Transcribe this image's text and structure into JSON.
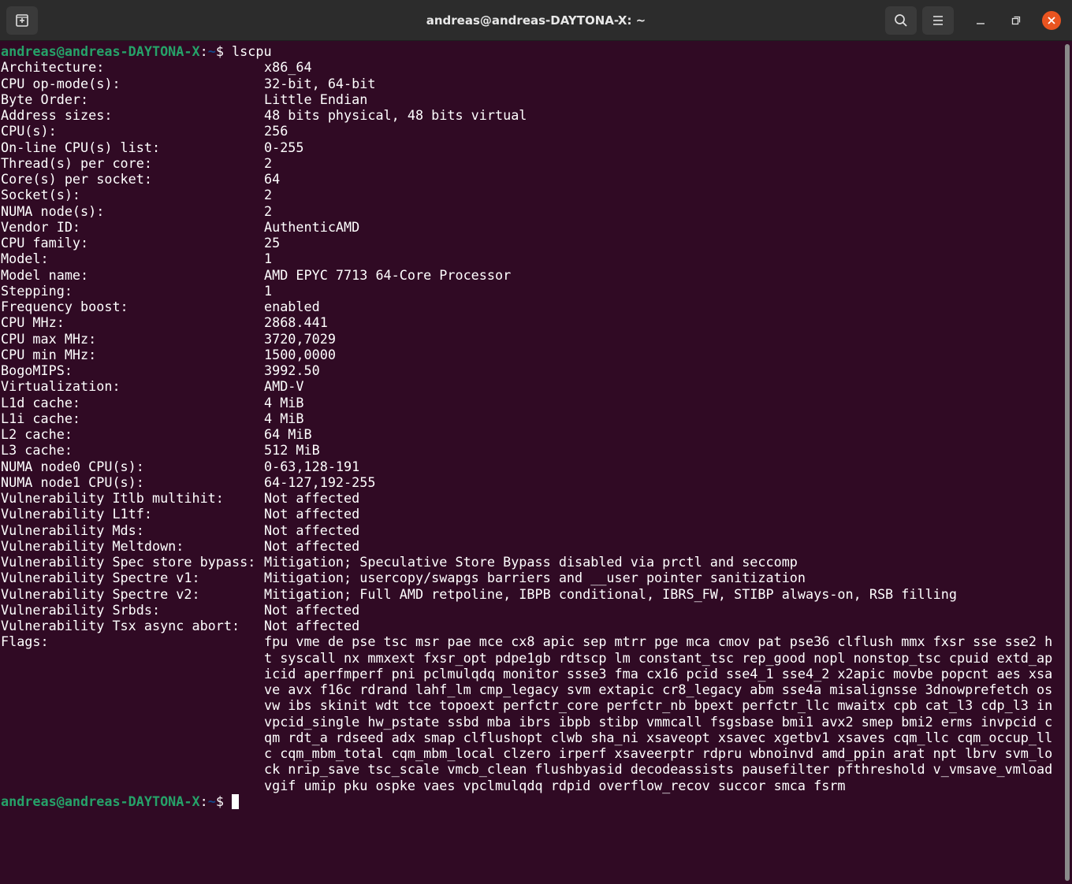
{
  "window": {
    "title": "andreas@andreas-DAYTONA-X: ~"
  },
  "prompt": {
    "user_host": "andreas@andreas-DAYTONA-X",
    "sep": ":",
    "path": "~",
    "symbol": "$ "
  },
  "command": "lscpu",
  "rows": [
    {
      "key": "Architecture:",
      "value": "x86_64"
    },
    {
      "key": "CPU op-mode(s):",
      "value": "32-bit, 64-bit"
    },
    {
      "key": "Byte Order:",
      "value": "Little Endian"
    },
    {
      "key": "Address sizes:",
      "value": "48 bits physical, 48 bits virtual"
    },
    {
      "key": "CPU(s):",
      "value": "256"
    },
    {
      "key": "On-line CPU(s) list:",
      "value": "0-255"
    },
    {
      "key": "Thread(s) per core:",
      "value": "2"
    },
    {
      "key": "Core(s) per socket:",
      "value": "64"
    },
    {
      "key": "Socket(s):",
      "value": "2"
    },
    {
      "key": "NUMA node(s):",
      "value": "2"
    },
    {
      "key": "Vendor ID:",
      "value": "AuthenticAMD"
    },
    {
      "key": "CPU family:",
      "value": "25"
    },
    {
      "key": "Model:",
      "value": "1"
    },
    {
      "key": "Model name:",
      "value": "AMD EPYC 7713 64-Core Processor"
    },
    {
      "key": "Stepping:",
      "value": "1"
    },
    {
      "key": "Frequency boost:",
      "value": "enabled"
    },
    {
      "key": "CPU MHz:",
      "value": "2868.441"
    },
    {
      "key": "CPU max MHz:",
      "value": "3720,7029"
    },
    {
      "key": "CPU min MHz:",
      "value": "1500,0000"
    },
    {
      "key": "BogoMIPS:",
      "value": "3992.50"
    },
    {
      "key": "Virtualization:",
      "value": "AMD-V"
    },
    {
      "key": "L1d cache:",
      "value": "4 MiB"
    },
    {
      "key": "L1i cache:",
      "value": "4 MiB"
    },
    {
      "key": "L2 cache:",
      "value": "64 MiB"
    },
    {
      "key": "L3 cache:",
      "value": "512 MiB"
    },
    {
      "key": "NUMA node0 CPU(s):",
      "value": "0-63,128-191"
    },
    {
      "key": "NUMA node1 CPU(s):",
      "value": "64-127,192-255"
    },
    {
      "key": "Vulnerability Itlb multihit:",
      "value": "Not affected"
    },
    {
      "key": "Vulnerability L1tf:",
      "value": "Not affected"
    },
    {
      "key": "Vulnerability Mds:",
      "value": "Not affected"
    },
    {
      "key": "Vulnerability Meltdown:",
      "value": "Not affected"
    },
    {
      "key": "Vulnerability Spec store bypass:",
      "value": "Mitigation; Speculative Store Bypass disabled via prctl and seccomp"
    },
    {
      "key": "Vulnerability Spectre v1:",
      "value": "Mitigation; usercopy/swapgs barriers and __user pointer sanitization"
    },
    {
      "key": "Vulnerability Spectre v2:",
      "value": "Mitigation; Full AMD retpoline, IBPB conditional, IBRS_FW, STIBP always-on, RSB filling"
    },
    {
      "key": "Vulnerability Srbds:",
      "value": "Not affected"
    },
    {
      "key": "Vulnerability Tsx async abort:",
      "value": "Not affected"
    }
  ],
  "flags": {
    "key": "Flags:",
    "value": "fpu vme de pse tsc msr pae mce cx8 apic sep mtrr pge mca cmov pat pse36 clflush mmx fxsr sse sse2 ht syscall nx mmxext fxsr_opt pdpe1gb rdtscp lm constant_tsc rep_good nopl nonstop_tsc cpuid extd_apicid aperfmperf pni pclmulqdq monitor ssse3 fma cx16 pcid sse4_1 sse4_2 x2apic movbe popcnt aes xsave avx f16c rdrand lahf_lm cmp_legacy svm extapic cr8_legacy abm sse4a misalignsse 3dnowprefetch osvw ibs skinit wdt tce topoext perfctr_core perfctr_nb bpext perfctr_llc mwaitx cpb cat_l3 cdp_l3 invpcid_single hw_pstate ssbd mba ibrs ibpb stibp vmmcall fsgsbase bmi1 avx2 smep bmi2 erms invpcid cqm rdt_a rdseed adx smap clflushopt clwb sha_ni xsaveopt xsavec xgetbv1 xsaves cqm_llc cqm_occup_llc cqm_mbm_total cqm_mbm_local clzero irperf xsaveerptr rdpru wbnoinvd amd_ppin arat npt lbrv svm_lock nrip_save tsc_scale vmcb_clean flushbyasid decodeassists pausefilter pfthreshold v_vmsave_vmload vgif umip pku ospke vaes vpclmulqdq rdpid overflow_recov succor smca fsrm"
  },
  "colors": {
    "background": "#300a24",
    "prompt_user": "#26a269",
    "prompt_path": "#12488b",
    "close_button": "#e95420"
  },
  "icons": {
    "new_tab": "new-tab-icon",
    "search": "search-icon",
    "menu": "hamburger-menu-icon",
    "minimize": "minimize-icon",
    "maximize": "maximize-icon",
    "close": "close-icon"
  }
}
